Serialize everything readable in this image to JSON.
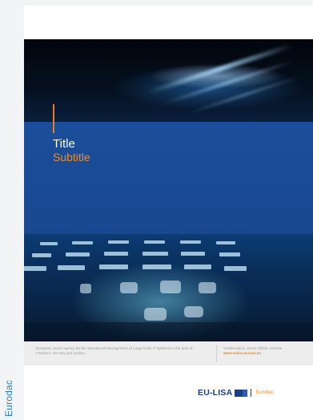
{
  "side_label": "Eurodac",
  "cover": {
    "title": "Title",
    "subtitle": "Subtitle",
    "accent_color": "#f08a24",
    "band_color": "#1b4e9a"
  },
  "footer": {
    "left_text": "European Union Agency for the Operational Management of Large-scale IT Systems in the area of Freedom, Security and Justice",
    "address": "Vesilennuki 5, 10415 Tallinn, Estonia",
    "url": "www.eulisa.europa.eu"
  },
  "logo": {
    "name": "EU-LISA",
    "system": "Eurodac"
  }
}
